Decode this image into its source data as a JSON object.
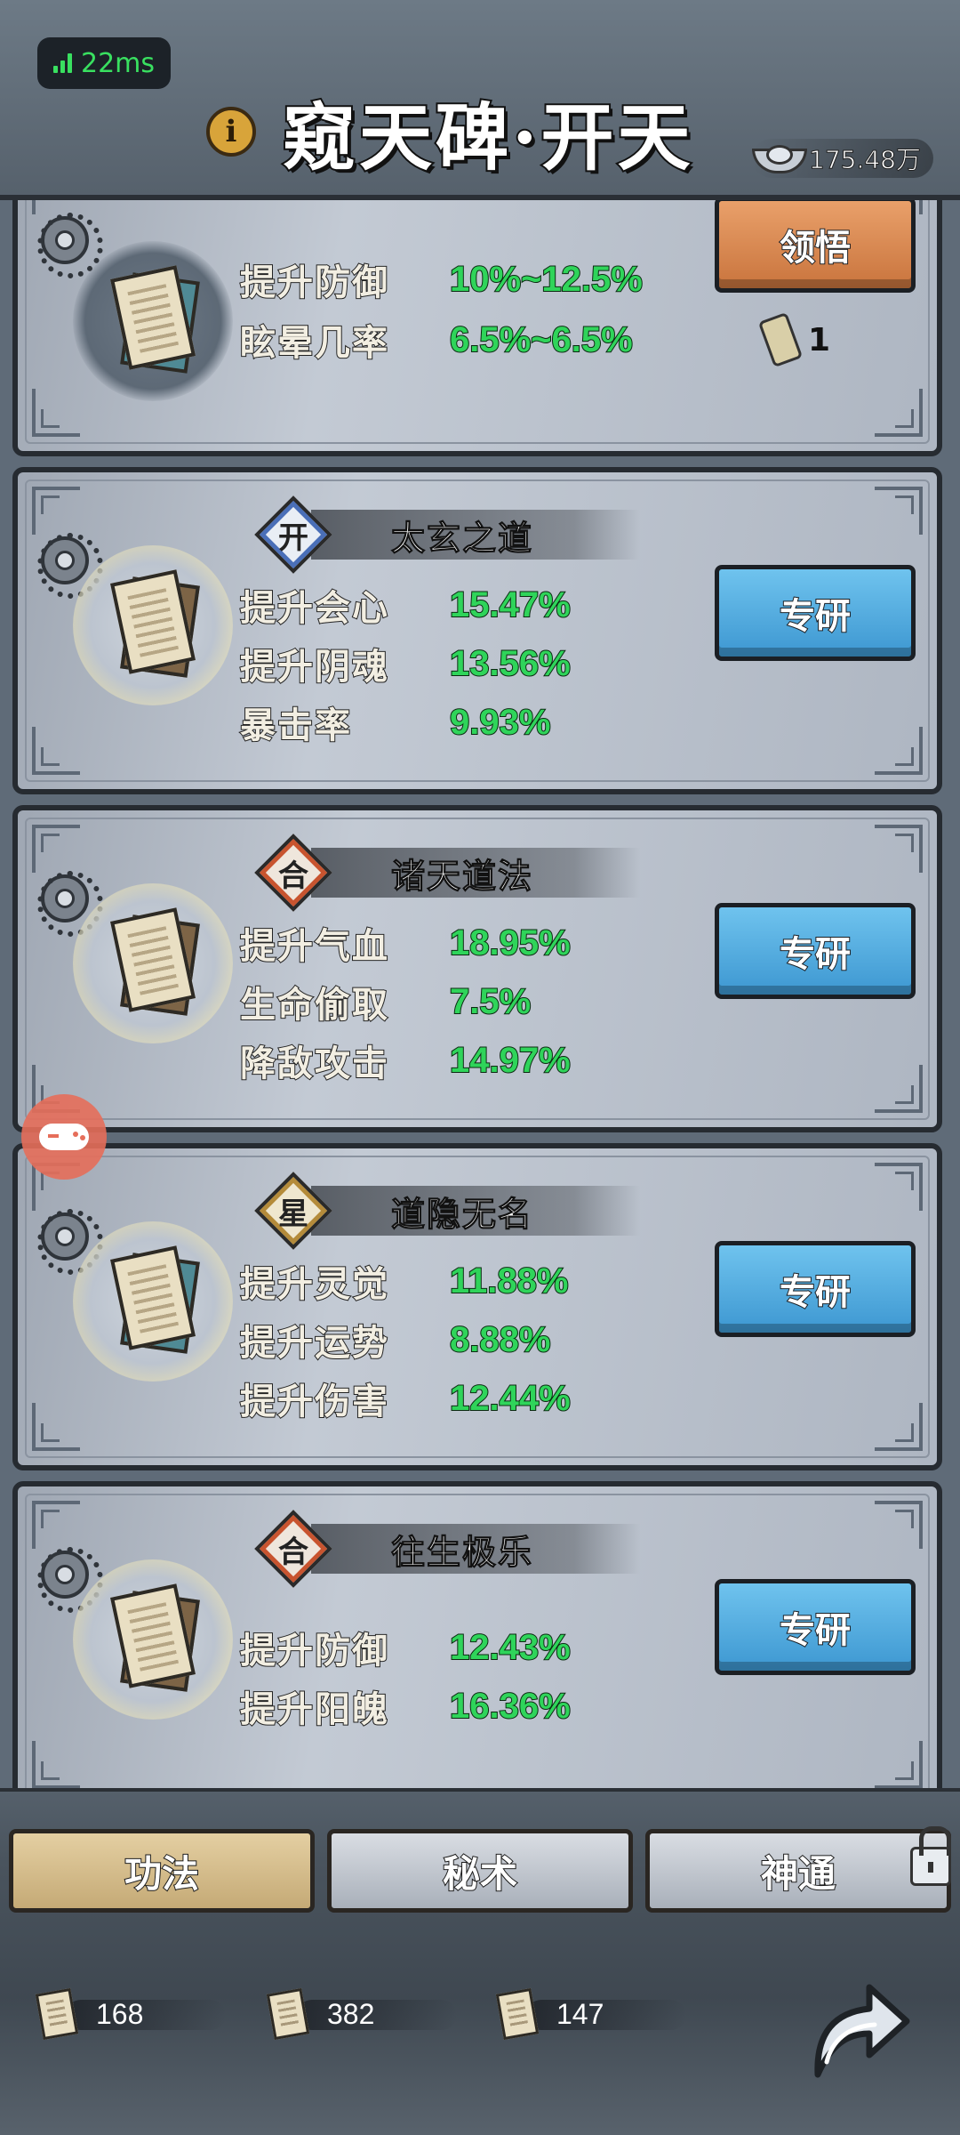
{
  "status": {
    "ping": "22ms"
  },
  "header": {
    "title": "窥天碑·开天",
    "silver_amount": "175.48万"
  },
  "cards": [
    {
      "name": "",
      "tier": "",
      "stats": [
        {
          "label": "提升防御",
          "value": "10%~12.5%"
        },
        {
          "label": "眩晕几率",
          "value": "6.5%~6.5%"
        }
      ],
      "button": "领悟",
      "token_count": "1"
    },
    {
      "name": "太玄之道",
      "tier": "开",
      "stats": [
        {
          "label": "提升会心",
          "value": "15.47%"
        },
        {
          "label": "提升阴魂",
          "value": "13.56%"
        },
        {
          "label": "暴击率",
          "value": "9.93%"
        }
      ],
      "button": "专研"
    },
    {
      "name": "诸天道法",
      "tier": "合",
      "stats": [
        {
          "label": "提升气血",
          "value": "18.95%"
        },
        {
          "label": "生命偷取",
          "value": "7.5%"
        },
        {
          "label": "降敌攻击",
          "value": "14.97%"
        }
      ],
      "button": "专研"
    },
    {
      "name": "道隐无名",
      "tier": "星",
      "stats": [
        {
          "label": "提升灵觉",
          "value": "11.88%"
        },
        {
          "label": "提升运势",
          "value": "8.88%"
        },
        {
          "label": "提升伤害",
          "value": "12.44%"
        }
      ],
      "button": "专研"
    },
    {
      "name": "往生极乐",
      "tier": "合",
      "stats": [
        {
          "label": "提升防御",
          "value": "12.43%"
        },
        {
          "label": "提升阳魄",
          "value": "16.36%"
        }
      ],
      "button": "专研"
    }
  ],
  "tabs": [
    {
      "label": "功法",
      "state": "active"
    },
    {
      "label": "秘术",
      "state": "idle"
    },
    {
      "label": "神通",
      "state": "locked"
    }
  ],
  "currencies": [
    "168",
    "382",
    "147"
  ],
  "colors": {
    "stat_value_green": "#2fd45a",
    "button_blue": "#4fa8dc",
    "button_orange": "#d8844a",
    "tier_kai": "#4a6fb8",
    "tier_he": "#c8542f",
    "tier_xing": "#b48b3a"
  },
  "icons": [
    "signal-icon",
    "info-icon",
    "silver-ingot-icon",
    "gear-icon",
    "scroll-icon",
    "token-icon",
    "gamepad-icon",
    "lock-icon",
    "share-arrow-icon"
  ]
}
